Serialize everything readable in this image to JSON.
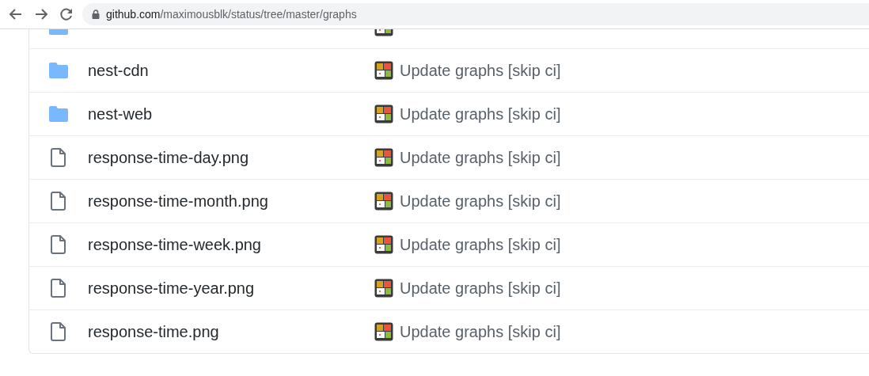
{
  "browser": {
    "url_host": "github.com",
    "url_path": "/maximousblk/status/tree/master/graphs"
  },
  "files": [
    {
      "kind": "folder"
    },
    {
      "kind": "folder",
      "name": "nest-cdn",
      "message": "Update graphs [skip ci]"
    },
    {
      "kind": "folder",
      "name": "nest-web",
      "message": "Update graphs [skip ci]"
    },
    {
      "kind": "file",
      "name": "response-time-day.png",
      "message": "Update graphs [skip ci]"
    },
    {
      "kind": "file",
      "name": "response-time-month.png",
      "message": "Update graphs [skip ci]"
    },
    {
      "kind": "file",
      "name": "response-time-week.png",
      "message": "Update graphs [skip ci]"
    },
    {
      "kind": "file",
      "name": "response-time-year.png",
      "message": "Update graphs [skip ci]"
    },
    {
      "kind": "file",
      "name": "response-time.png",
      "message": "Update graphs [skip ci]"
    }
  ]
}
